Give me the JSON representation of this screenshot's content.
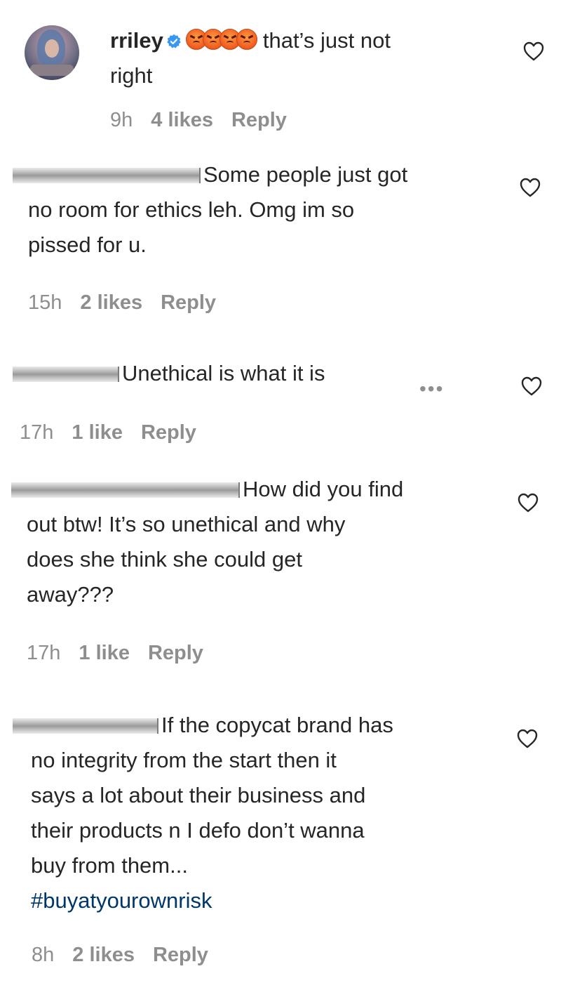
{
  "comments": [
    {
      "username": "rriley",
      "verified": true,
      "emoji_count": 4,
      "text_line1": "that’s just not",
      "text_line2": "right",
      "time": "9h",
      "likes": "4 likes",
      "reply": "Reply"
    },
    {
      "text_line1": "Some people just got",
      "text_line2": "no room for ethics leh. Omg im so",
      "text_line3": "pissed for u.",
      "time": "15h",
      "likes": "2 likes",
      "reply": "Reply"
    },
    {
      "text_line1": "Unethical is what it is",
      "more": "•••",
      "time": "17h",
      "likes": "1 like",
      "reply": "Reply"
    },
    {
      "text_line1": "How did you find",
      "text_line2": "out btw! It’s so unethical and why",
      "text_line3": "does she think she could get",
      "text_line4": "away???",
      "time": "17h",
      "likes": "1 like",
      "reply": "Reply"
    },
    {
      "text_line1": "If the copycat brand has",
      "text_line2": "no integrity from the start then it",
      "text_line3": "says a lot about their business and",
      "text_line4": "their products n I defo don’t wanna",
      "text_line5": "buy from them...",
      "hashtag": "#buyatyourownrisk",
      "time": "8h",
      "likes": "2 likes",
      "reply": "Reply"
    }
  ],
  "icons": {
    "heart": "heart-outline-icon",
    "verified": "verified-badge-icon",
    "emoji": "angry-face-emoji"
  },
  "colors": {
    "text": "#262626",
    "meta": "#8e8e8e",
    "hashtag": "#00376b",
    "verified": "#3897f0"
  }
}
